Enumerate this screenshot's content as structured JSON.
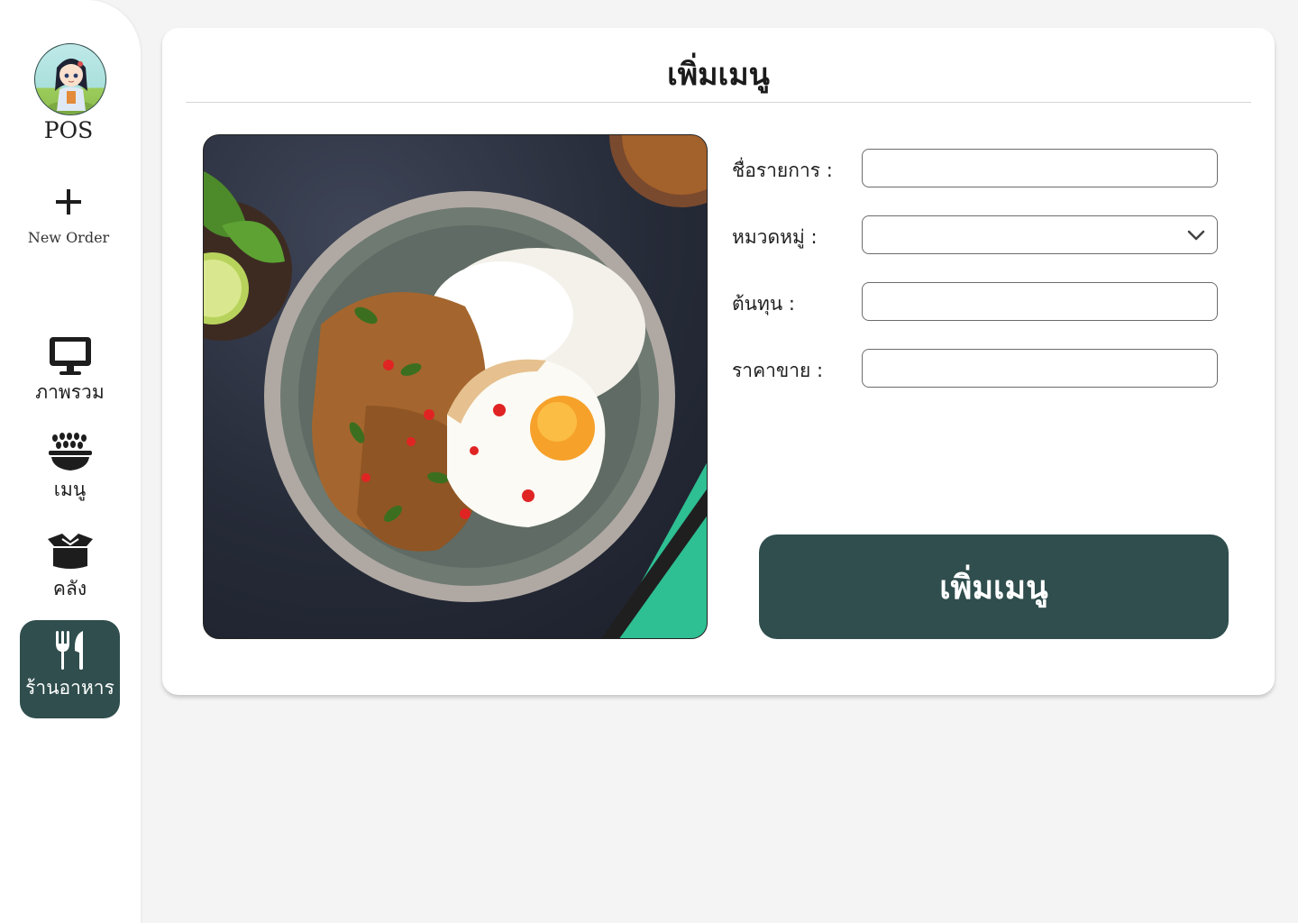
{
  "sidebar": {
    "brand": "POS",
    "new_order": {
      "label": "New Order",
      "icon": "plus-icon"
    },
    "items": [
      {
        "label": "ภาพรวม",
        "icon": "monitor-icon",
        "active": false
      },
      {
        "label": "เมนู",
        "icon": "food-bowl-icon",
        "active": false
      },
      {
        "label": "คลัง",
        "icon": "box-icon",
        "active": false
      },
      {
        "label": "ร้านอาหาร",
        "icon": "utensils-icon",
        "active": true
      }
    ]
  },
  "main": {
    "title": "เพิ่มเมนู",
    "image": {
      "subject": "stir-fried basil pork with rice and fried egg"
    },
    "form": {
      "name_label": "ชื่อรายการ :",
      "name_value": "",
      "category_label": "หมวดหมู่ :",
      "category_value": "",
      "cost_label": "ต้นทุน :",
      "cost_value": "",
      "price_label": "ราคาขาย :",
      "price_value": ""
    },
    "submit_label": "เพิ่มเมนู"
  },
  "colors": {
    "accent": "#2f4e4d",
    "background": "#f4f4f4",
    "card": "#ffffff"
  }
}
